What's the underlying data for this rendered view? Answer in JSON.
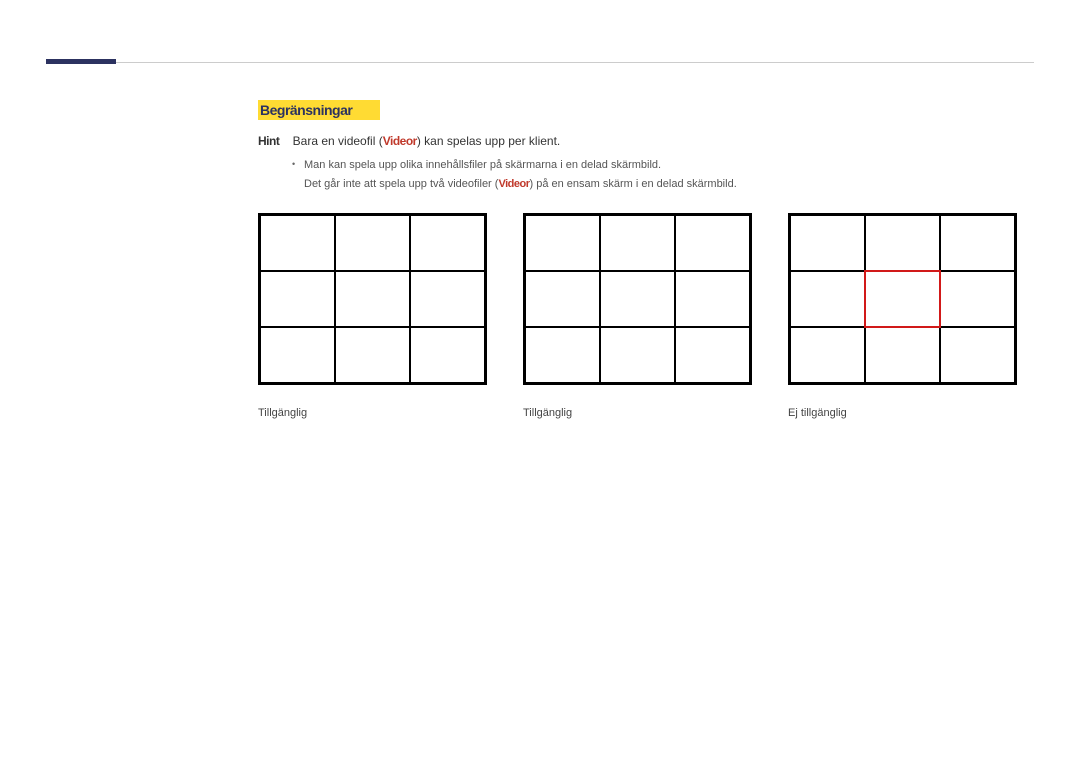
{
  "section_title": "Begränsningar",
  "intro": {
    "label": "Hint",
    "before": "Bara en videofil (",
    "highlight": "Videor",
    "after": ") kan spelas upp per klient."
  },
  "bullets": {
    "b1": "Man kan spela upp olika innehållsfiler på skärmarna i en delad skärmbild.",
    "b2_before": "Det går inte att spela upp två videofiler (",
    "b2_highlight": "Videor",
    "b2_after": ") på en ensam skärm i en delad skärmbild."
  },
  "captions": {
    "g1": "Tillgänglig",
    "g2": "Tillgänglig",
    "g3": "Ej tillgänglig"
  }
}
